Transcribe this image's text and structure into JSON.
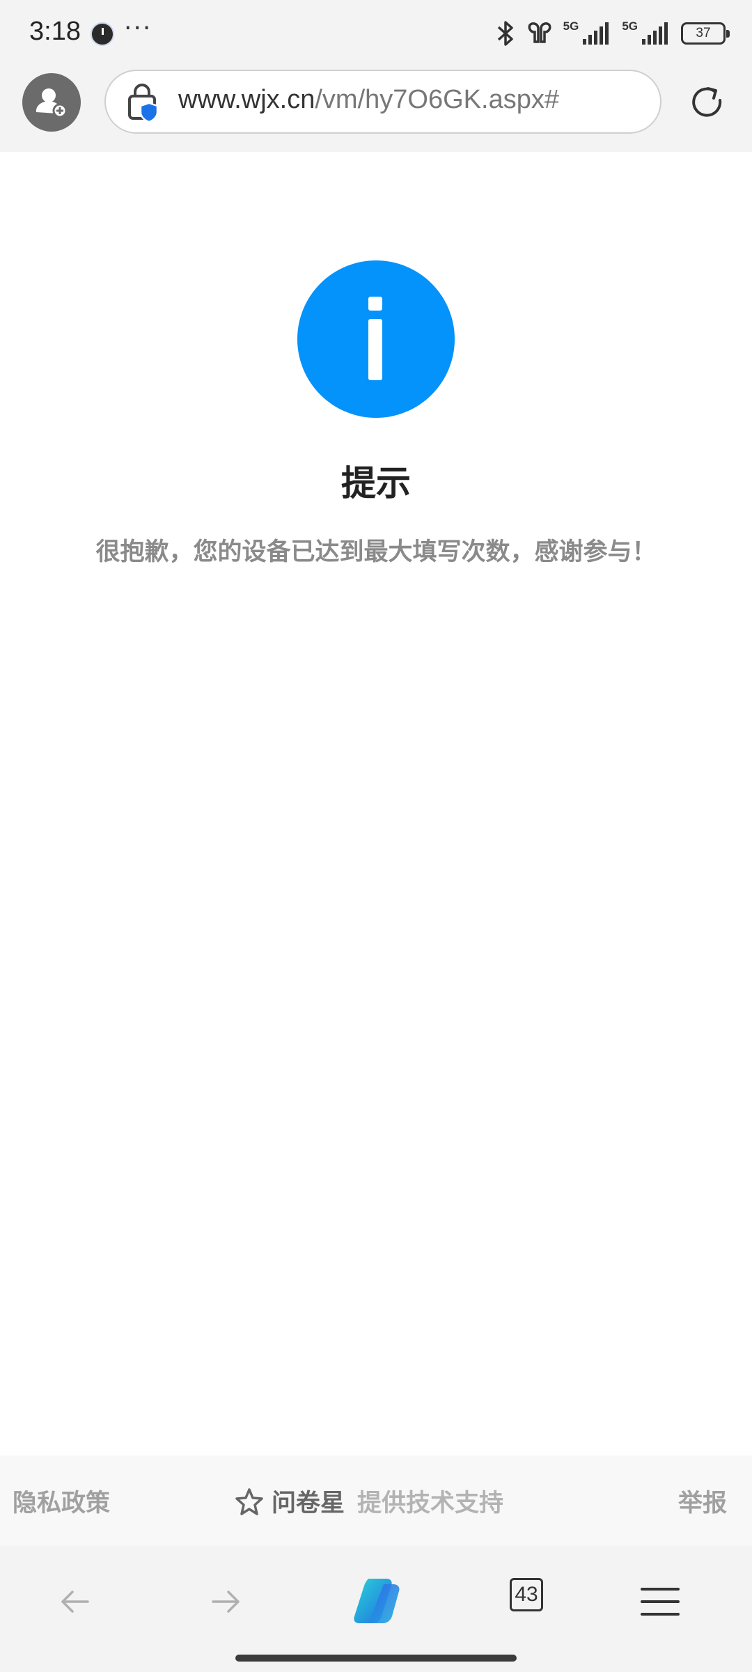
{
  "status_bar": {
    "time": "3:18",
    "more": "···",
    "network_1": "5G",
    "network_2": "5G",
    "battery": "37",
    "icons": [
      "clock-icon",
      "bluetooth-icon",
      "earbuds-icon",
      "signal-icon",
      "signal-icon",
      "battery-icon"
    ]
  },
  "browser": {
    "url_host": "www.wjx.cn",
    "url_path": "/vm/hy7O6GK.aspx#",
    "tab_count": "43"
  },
  "page": {
    "title": "提示",
    "message": "很抱歉，您的设备已达到最大填写次数，感谢参与！",
    "accent_color": "#0492fb"
  },
  "footer": {
    "privacy": "隐私政策",
    "brand_name": "问卷星",
    "brand_tag": "提供技术支持",
    "report": "举报"
  }
}
